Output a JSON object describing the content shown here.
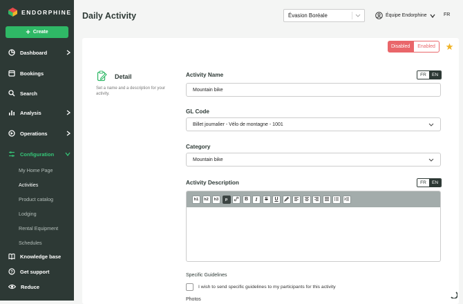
{
  "sidebar": {
    "brand": "ENDORPHINE",
    "create_label": "Create",
    "items": [
      {
        "label": "Dashboard"
      },
      {
        "label": "Bookings"
      },
      {
        "label": "Search"
      },
      {
        "label": "Analysis"
      },
      {
        "label": "Operations"
      },
      {
        "label": "Configuration"
      }
    ],
    "sub_items": [
      {
        "label": "My Home Page"
      },
      {
        "label": "Activities"
      },
      {
        "label": "Product catalog"
      },
      {
        "label": "Lodging"
      },
      {
        "label": "Rental Equipment"
      },
      {
        "label": "Schedules"
      }
    ],
    "bottom": [
      {
        "label": "Knowledge base"
      },
      {
        "label": "Get support"
      },
      {
        "label": "Reduce"
      }
    ]
  },
  "header": {
    "title": "Daily Activity",
    "org_value": "Évasion Boréale",
    "team": "Équipe Endorphine",
    "language": "FR"
  },
  "status_toggle": {
    "disabled": "Disabled",
    "enabled": "Enabled"
  },
  "detail": {
    "title": "Detail",
    "description": "Set a name and a description for your activity."
  },
  "form": {
    "activity_name_label": "Activity Name",
    "activity_name_value": "Mountain bike",
    "gl_code_label": "GL Code",
    "gl_code_value": "Billet journalier - Vélo de montagne - 1001",
    "category_label": "Category",
    "category_value": "Mountain bike",
    "description_label": "Activity Description",
    "lang_fr": "FR",
    "lang_en": "EN",
    "toolbar": [
      "h1",
      "h2",
      "h3",
      "p"
    ],
    "guidelines_label": "Specific Guidelines",
    "guidelines_checkbox": "I wish to send specific guidelines to my participants for this activity",
    "photos_label": "Photos"
  },
  "colors": {
    "sidebar": "#2d3935",
    "accent": "#2fb866",
    "danger": "#e9666a",
    "star": "#f0b429"
  }
}
